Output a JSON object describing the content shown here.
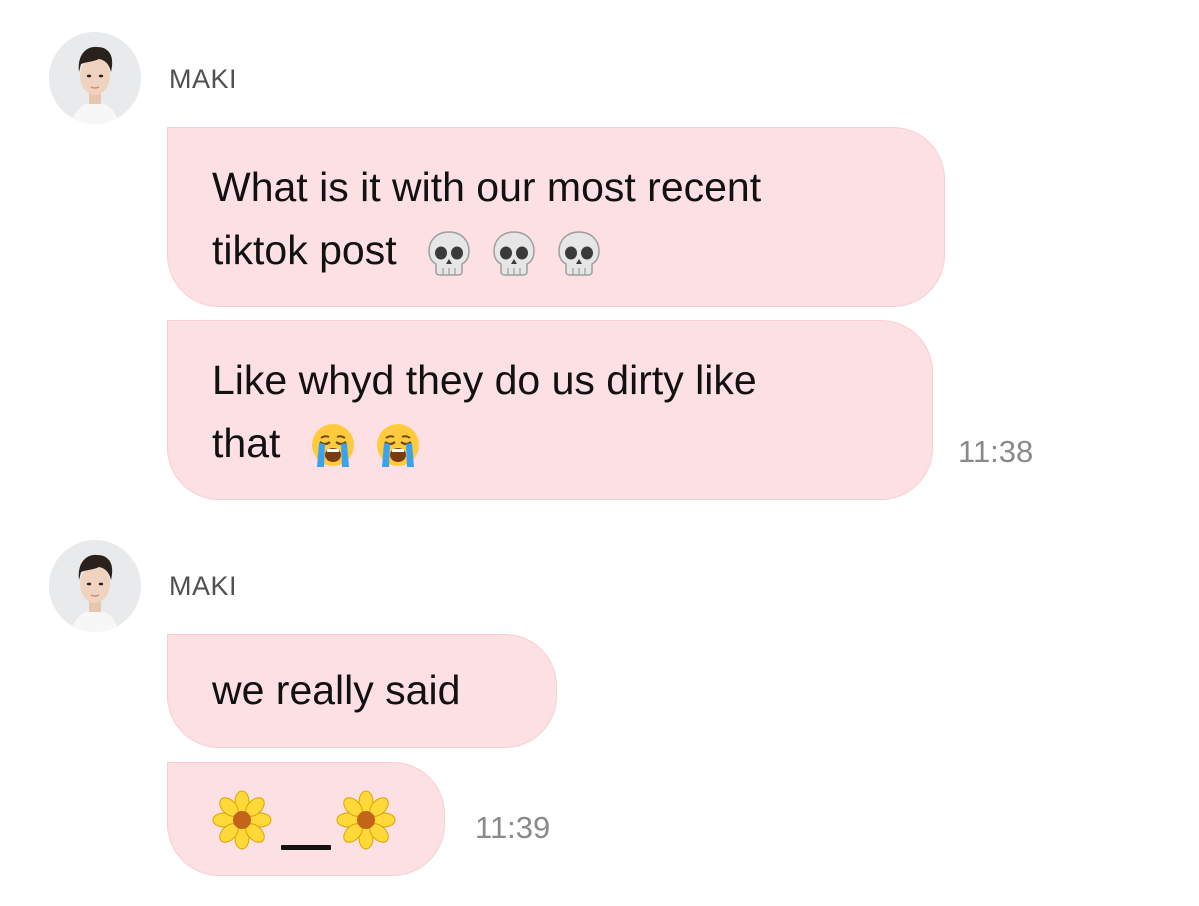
{
  "groups": [
    {
      "sender": "MAKI",
      "avatar_icon": "profile-photo",
      "messages": [
        {
          "lines": [
            "What is it with our most recent",
            "tiktok post"
          ],
          "trailing_emoji": [
            "skull",
            "skull",
            "skull"
          ]
        },
        {
          "lines": [
            "Like whyd they do us dirty like",
            "that"
          ],
          "trailing_emoji": [
            "loudly-crying-face",
            "loudly-crying-face"
          ]
        }
      ],
      "time": "11:38"
    },
    {
      "sender": "MAKI",
      "avatar_icon": "profile-photo",
      "messages": [
        {
          "lines": [
            "we really said"
          ]
        },
        {
          "emoji_sequence": [
            "blossom",
            "underscore",
            "blossom"
          ]
        }
      ],
      "time": "11:39"
    }
  ],
  "colors": {
    "bubble": "#fde0e4",
    "bubble_border": "#f8cfd5",
    "name": "#505050",
    "timestamp": "#8a8a8a",
    "text": "#111111"
  }
}
